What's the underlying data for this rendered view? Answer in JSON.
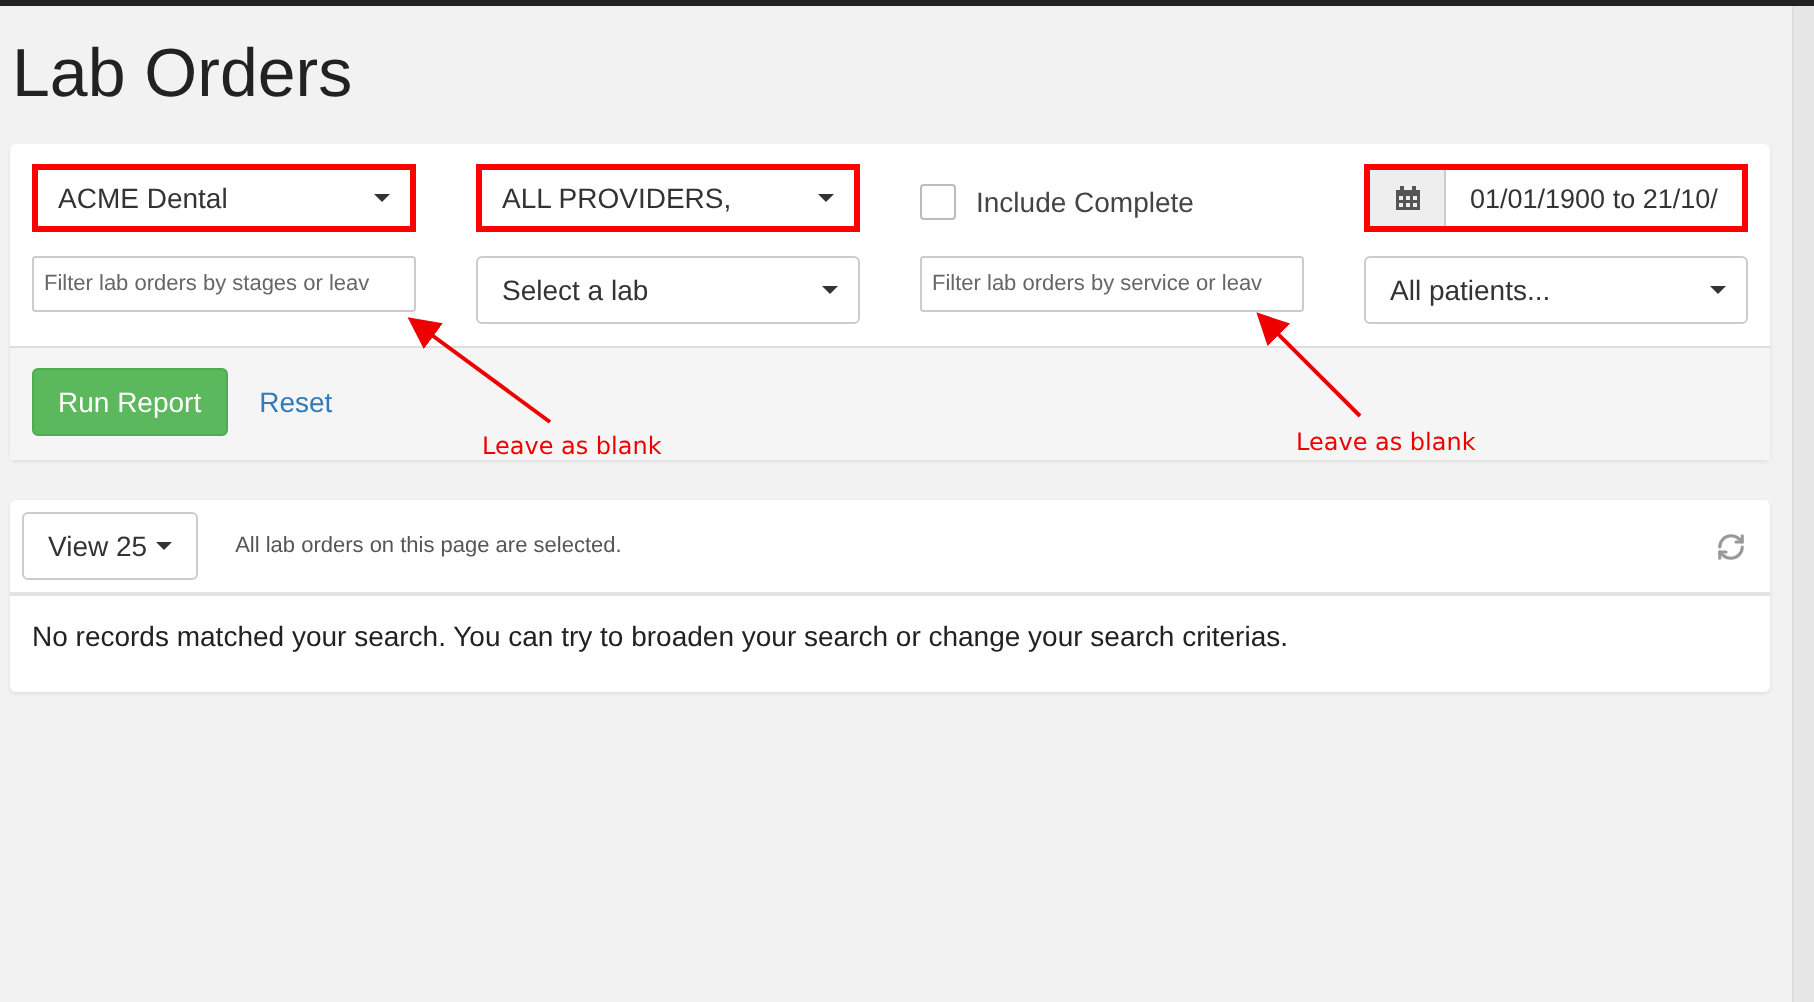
{
  "page_title": "Lab Orders",
  "filters": [
    {
      "kind": "select",
      "value": "ACME Dental",
      "highlighted": true
    },
    {
      "kind": "select",
      "value": "ALL PROVIDERS,",
      "highlighted": true
    },
    {
      "kind": "checkbox",
      "label": "Include Complete",
      "checked": false
    },
    {
      "kind": "date",
      "value": "01/01/1900 to 21/10/",
      "highlighted": true
    },
    {
      "kind": "text",
      "placeholder": "Filter lab orders by stages or leav"
    },
    {
      "kind": "select",
      "value": "Select a lab",
      "highlighted": false
    },
    {
      "kind": "text",
      "placeholder": "Filter lab orders by service or leav"
    },
    {
      "kind": "select",
      "value": "All patients...",
      "highlighted": false
    }
  ],
  "actions": {
    "run": "Run Report",
    "reset": "Reset"
  },
  "annotations": [
    {
      "text": "Leave as blank"
    },
    {
      "text": "Leave as blank"
    }
  ],
  "results": {
    "page_size": "View 25",
    "selection_note": "All lab orders on this page are selected.",
    "empty_message": "No records matched your search. You can try to broaden your search or change your search criterias."
  }
}
